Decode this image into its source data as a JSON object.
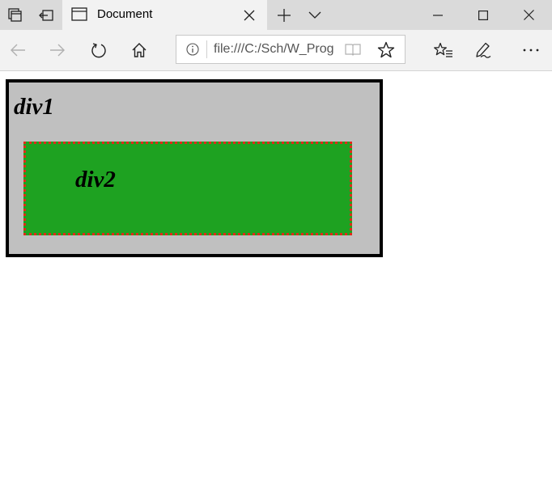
{
  "browser": {
    "tab": {
      "title": "Document",
      "icon": "page-icon"
    },
    "address_bar": {
      "url": "file:///C:/Sch/W_Prog",
      "info_icon": "info-icon"
    },
    "colors": {
      "titlebar": "#dadada",
      "tab_active": "#f2f2f2",
      "toolbar": "#f2f2f2"
    }
  },
  "page": {
    "div1": {
      "label": "div1",
      "background": "#c0c0c0",
      "border": "#000000"
    },
    "div2": {
      "label": "div2",
      "background": "#1ea221",
      "border": "#e02a1a"
    }
  }
}
